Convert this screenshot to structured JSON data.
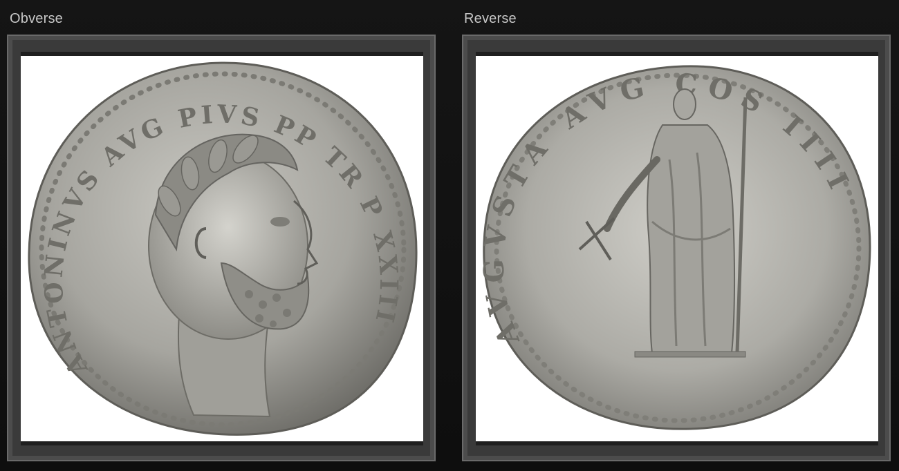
{
  "obverse": {
    "label": "Obverse",
    "legend": "ANTONINVS AVG PIVS PP TR P XXIII"
  },
  "reverse": {
    "label": "Reverse",
    "legend": "AVGVSTA AVG COS IIII"
  }
}
